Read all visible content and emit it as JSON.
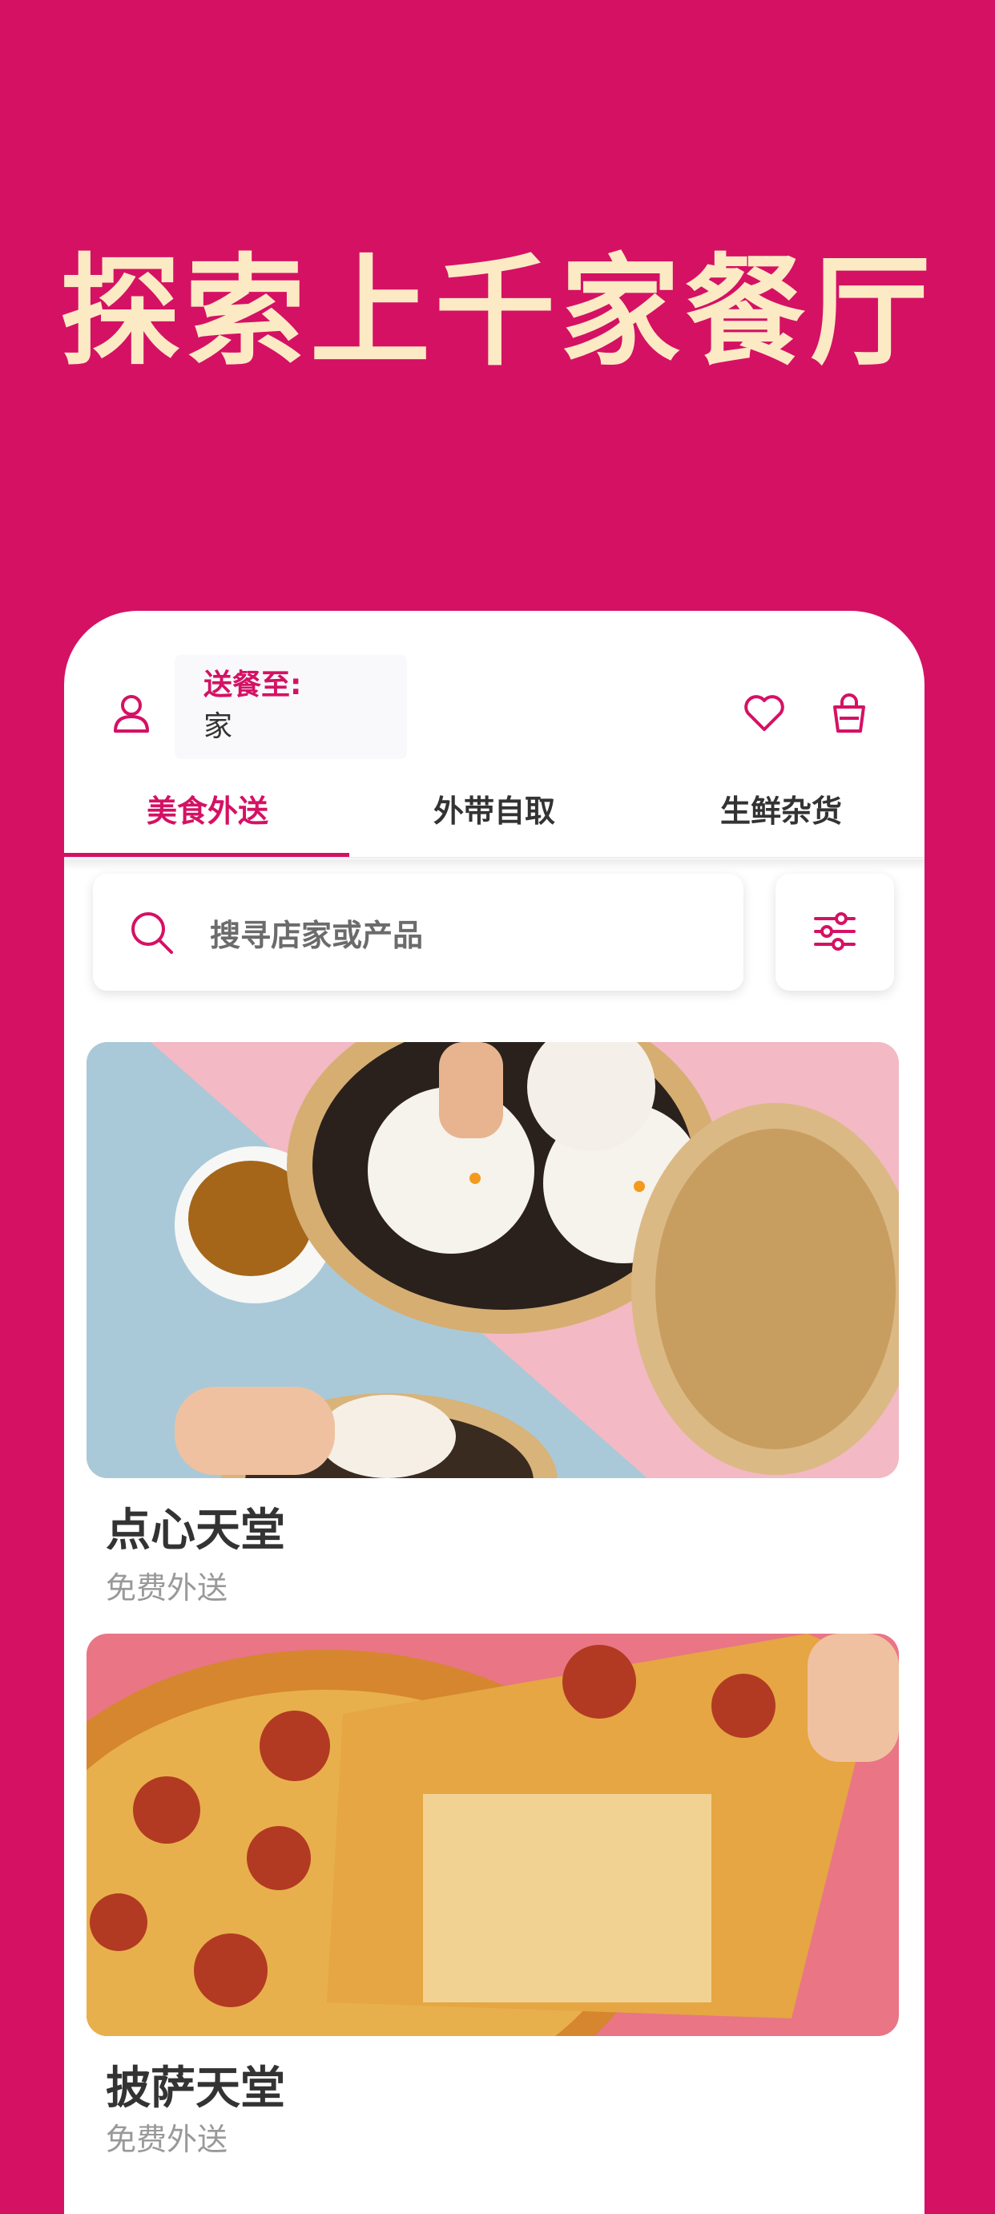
{
  "headline": "探索上千家餐厅",
  "header": {
    "deliver_label": "送餐至:",
    "deliver_value": "家"
  },
  "tabs": [
    {
      "label": "美食外送",
      "active": true
    },
    {
      "label": "外带自取",
      "active": false
    },
    {
      "label": "生鲜杂货",
      "active": false
    }
  ],
  "search": {
    "placeholder": "搜寻店家或产品"
  },
  "restaurants": [
    {
      "name": "点心天堂",
      "subtitle": "免费外送"
    },
    {
      "name": "披萨天堂",
      "subtitle": "免费外送"
    }
  ],
  "colors": {
    "brand": "#d51164",
    "headline": "#fbeac4"
  },
  "icons": [
    "user-icon",
    "heart-icon",
    "bag-icon",
    "search-icon",
    "filter-icon"
  ]
}
